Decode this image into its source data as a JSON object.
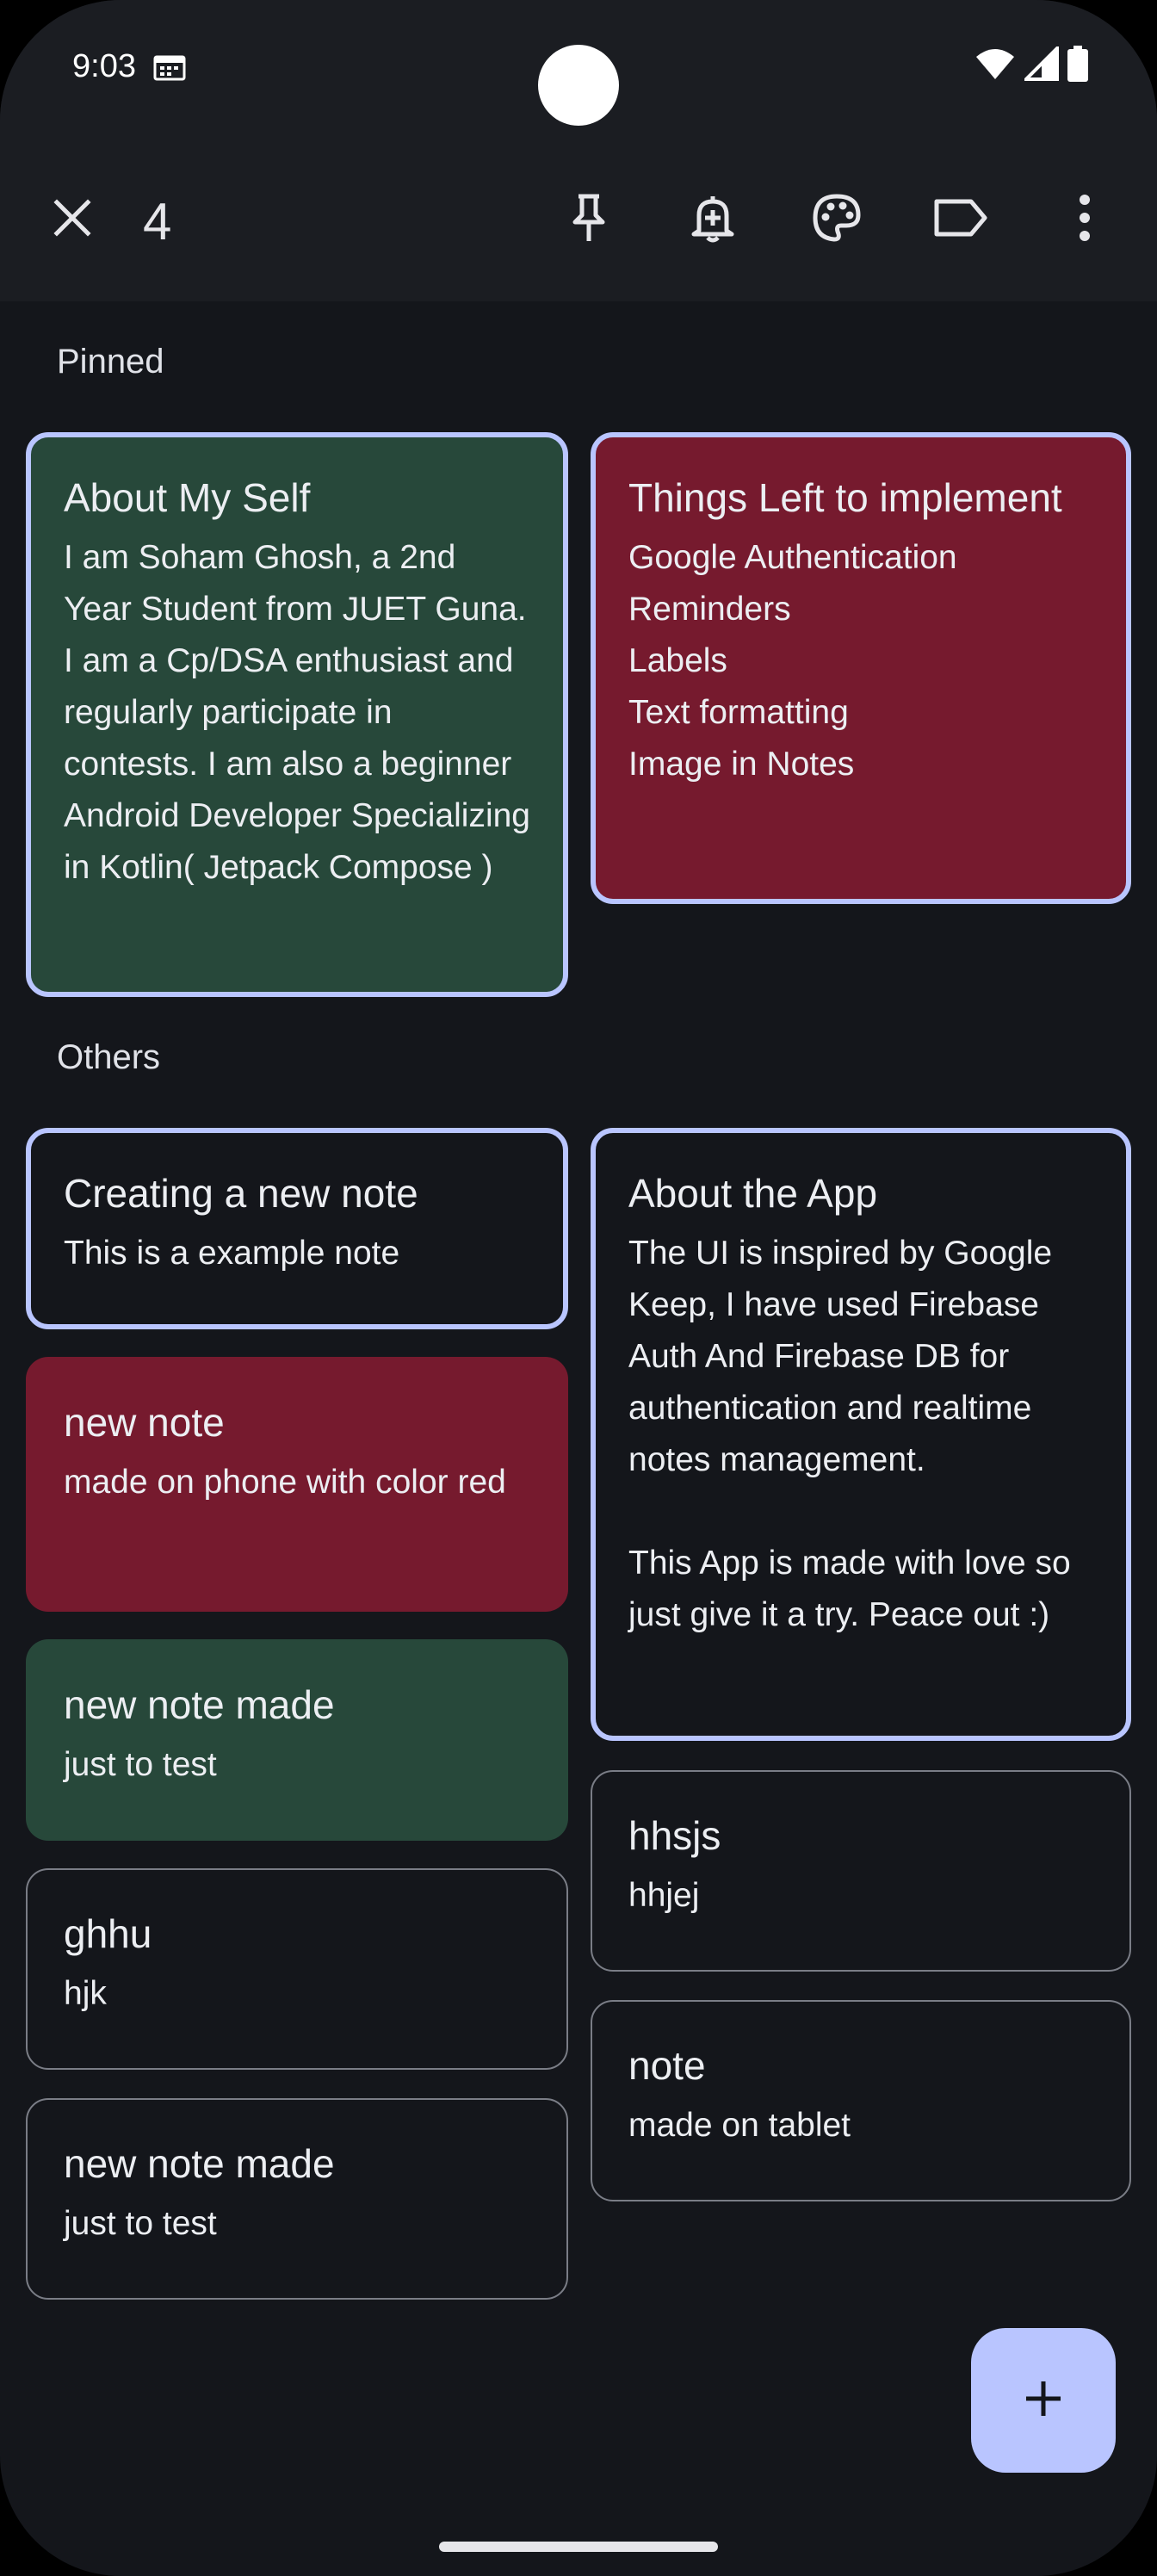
{
  "status_bar": {
    "time": "9:03",
    "icons": [
      "calendar-icon",
      "wifi-icon",
      "signal-icon",
      "battery-icon"
    ]
  },
  "top_bar": {
    "close_icon": "close-icon",
    "selected_count": "4",
    "actions": [
      "pin-icon",
      "add-reminder-icon",
      "palette-icon",
      "label-icon",
      "more-vert-icon"
    ]
  },
  "sections": {
    "pinned": "Pinned",
    "others": "Others"
  },
  "notes": {
    "about_me": {
      "title": "About My Self",
      "body": "I am Soham Ghosh, a 2nd Year Student from JUET Guna. I am a Cp/DSA enthusiast and regularly participate in contests. I am also a beginner Android Developer Specializing in Kotlin( Jetpack Compose )"
    },
    "things_left": {
      "title": "Things Left to implement",
      "body": "Google Authentication\nReminders\nLabels\nText formatting\nImage in Notes"
    },
    "creating_note": {
      "title": "Creating a new note",
      "body": "This is a example note"
    },
    "about_app": {
      "title": "About the App",
      "body": "The UI is inspired by Google Keep, I have used Firebase Auth And Firebase DB for authentication and realtime notes management.\n\nThis App is made with love so just give it a try. Peace out :)"
    },
    "new_note_red": {
      "title": "new note",
      "body": "made on phone with color red"
    },
    "new_note_made_green": {
      "title": "new note made",
      "body": "just to test"
    },
    "hhsjs": {
      "title": "hhsjs",
      "body": "hhjej"
    },
    "ghhu": {
      "title": "ghhu",
      "body": "hjk"
    },
    "note_tablet": {
      "title": "note",
      "body": "made on tablet"
    },
    "new_note_made_dark": {
      "title": "new note made",
      "body": "just to test"
    }
  },
  "fab": {
    "icon": "plus-icon"
  },
  "colors": {
    "background": "#14161b",
    "bar": "#1b1d22",
    "note_green": "#27483a",
    "note_red": "#761a2e",
    "selection_border": "#b9c5ff",
    "fab": "#b9c5ff"
  }
}
